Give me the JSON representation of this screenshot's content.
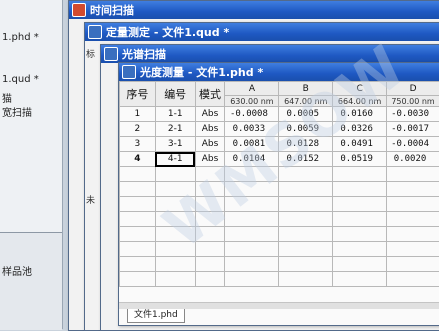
{
  "left_panel": {
    "lines": [
      "1.phd *",
      "",
      "",
      "1.qud *",
      "猫",
      "宽扫描"
    ],
    "bottom_lines": [
      "",
      "样品池",
      "",
      "",
      ""
    ]
  },
  "windows": {
    "time_scan": {
      "title": "时间扫描"
    },
    "quant": {
      "title": "定量测定 - 文件1.qud *"
    },
    "spectrum": {
      "title": "光谱扫描"
    },
    "photometric": {
      "title": "光度测量 - 文件1.phd *"
    }
  },
  "side_tabs": [
    "标",
    "未"
  ],
  "table": {
    "headers": {
      "index": "序号",
      "code": "编号",
      "mode": "模式",
      "cols": [
        {
          "letter": "A",
          "wavelength": "630.00 nm"
        },
        {
          "letter": "B",
          "wavelength": "647.00 nm"
        },
        {
          "letter": "C",
          "wavelength": "664.00 nm"
        },
        {
          "letter": "D",
          "wavelength": "750.00 nm"
        }
      ]
    },
    "rows": [
      {
        "index": "1",
        "code": "1-1",
        "mode": "Abs",
        "values": [
          "-0.0008",
          "0.0005",
          "0.0160",
          "-0.0030"
        ]
      },
      {
        "index": "2",
        "code": "2-1",
        "mode": "Abs",
        "values": [
          "0.0033",
          "0.0059",
          "0.0326",
          "-0.0017"
        ]
      },
      {
        "index": "3",
        "code": "3-1",
        "mode": "Abs",
        "values": [
          "0.0081",
          "0.0128",
          "0.0491",
          "-0.0004"
        ]
      },
      {
        "index": "4",
        "code": "4-1",
        "mode": "Abs",
        "values": [
          "0.0104",
          "0.0152",
          "0.0519",
          "0.0020"
        ]
      }
    ]
  },
  "bottom_tab": "文件1.phd",
  "watermark": "WMSOW"
}
